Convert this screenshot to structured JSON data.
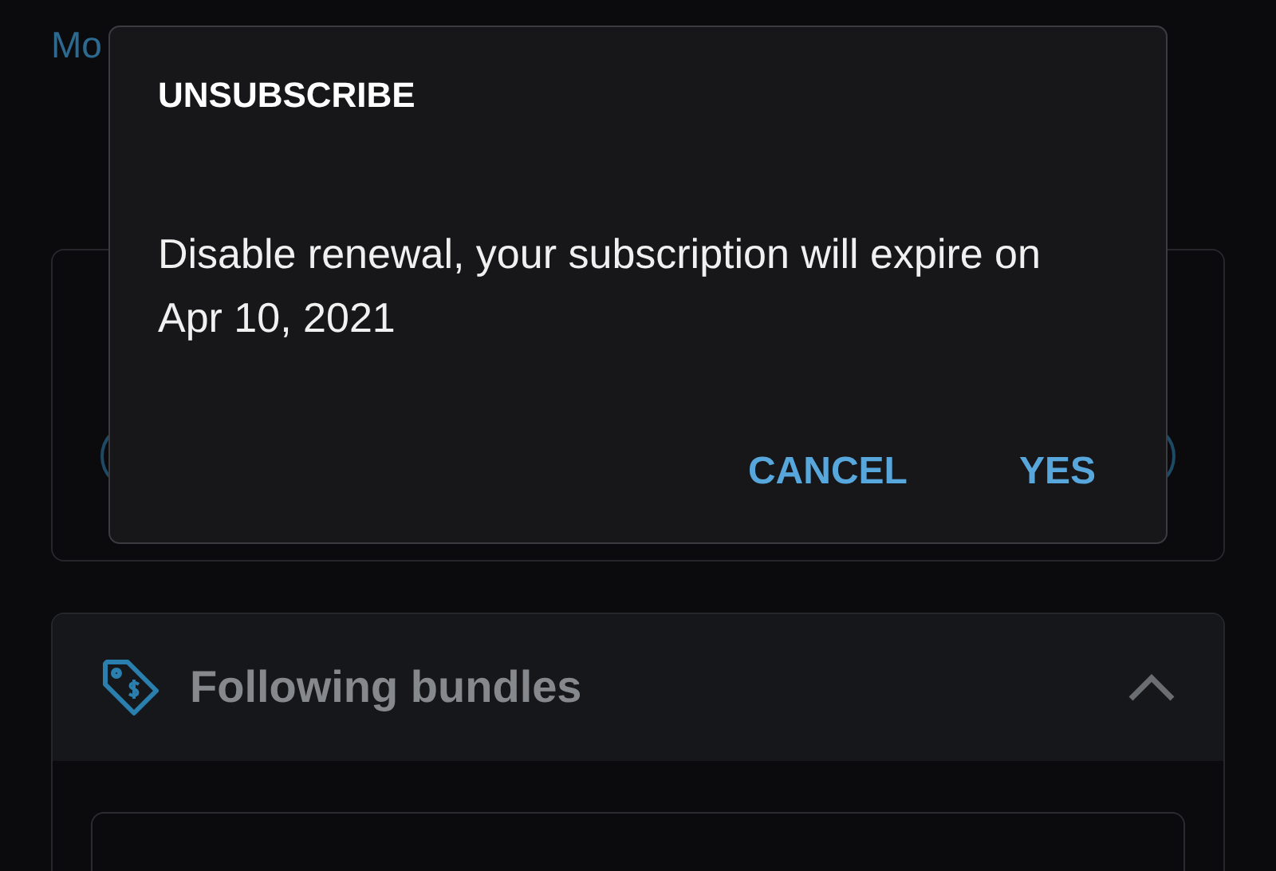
{
  "background": {
    "link": "Mo",
    "bundles": {
      "title": "Following bundles",
      "expanded": true
    }
  },
  "dialog": {
    "title": "UNSUBSCRIBE",
    "message": "Disable renewal, your subscription will expire on Apr 10, 2021",
    "buttons": [
      {
        "label": "CANCEL"
      },
      {
        "label": "YES"
      }
    ]
  }
}
